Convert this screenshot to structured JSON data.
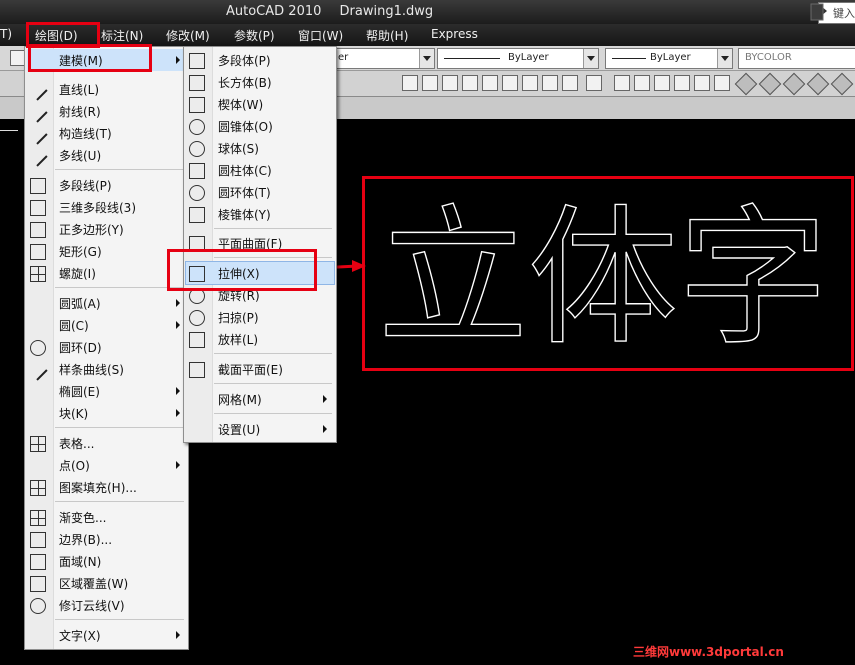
{
  "title_bar": {
    "app": "AutoCAD 2010",
    "doc": "Drawing1.dwg",
    "search_placeholder": "键入"
  },
  "menubar": {
    "items": [
      {
        "label": "T)"
      },
      {
        "label": "绘图(D)"
      },
      {
        "label": "标注(N)"
      },
      {
        "label": "修改(M)"
      },
      {
        "label": "参数(P)"
      },
      {
        "label": "窗口(W)"
      },
      {
        "label": "帮助(H)"
      },
      {
        "label": "Express"
      }
    ]
  },
  "toolbar": {
    "layer_value": "er",
    "linetype_value": "ByLayer",
    "lineweight_value": "ByLayer",
    "color_value": "BYCOLOR"
  },
  "draw_menu": {
    "items": [
      {
        "label": "建模(M)",
        "icon": "",
        "submenu": true
      },
      {
        "label": "直线(L)",
        "icon": "line-icon"
      },
      {
        "label": "射线(R)",
        "icon": "ray-icon"
      },
      {
        "label": "构造线(T)",
        "icon": "xline-icon"
      },
      {
        "label": "多线(U)",
        "icon": "mline-icon"
      },
      {
        "label": "多段线(P)",
        "icon": "polyline-icon"
      },
      {
        "label": "三维多段线(3)",
        "icon": "3dpoly-icon"
      },
      {
        "label": "正多边形(Y)",
        "icon": "polygon-icon"
      },
      {
        "label": "矩形(G)",
        "icon": "rectangle-icon"
      },
      {
        "label": "螺旋(I)",
        "icon": "helix-icon"
      },
      {
        "label": "圆弧(A)",
        "submenu": true
      },
      {
        "label": "圆(C)",
        "submenu": true
      },
      {
        "label": "圆环(D)",
        "icon": "donut-icon"
      },
      {
        "label": "样条曲线(S)",
        "icon": "spline-icon"
      },
      {
        "label": "椭圆(E)",
        "submenu": true
      },
      {
        "label": "块(K)",
        "submenu": true
      },
      {
        "label": "表格...",
        "icon": "table-icon"
      },
      {
        "label": "点(O)",
        "submenu": true
      },
      {
        "label": "图案填充(H)...",
        "icon": "hatch-icon"
      },
      {
        "label": "渐变色...",
        "icon": "gradient-icon"
      },
      {
        "label": "边界(B)...",
        "icon": "boundary-icon"
      },
      {
        "label": "面域(N)",
        "icon": "region-icon"
      },
      {
        "label": "区域覆盖(W)",
        "icon": "wipeout-icon"
      },
      {
        "label": "修订云线(V)",
        "icon": "revcloud-icon"
      },
      {
        "label": "文字(X)",
        "submenu": true
      }
    ]
  },
  "modeling_menu": {
    "items": [
      {
        "label": "多段体(P)",
        "icon": "polysolid-icon"
      },
      {
        "label": "长方体(B)",
        "icon": "box-icon"
      },
      {
        "label": "楔体(W)",
        "icon": "wedge-icon"
      },
      {
        "label": "圆锥体(O)",
        "icon": "cone-icon"
      },
      {
        "label": "球体(S)",
        "icon": "sphere-icon"
      },
      {
        "label": "圆柱体(C)",
        "icon": "cylinder-icon"
      },
      {
        "label": "圆环体(T)",
        "icon": "torus-icon"
      },
      {
        "label": "棱锥体(Y)",
        "icon": "pyramid-icon"
      },
      {
        "label": "平面曲面(F)",
        "icon": "planesurf-icon"
      },
      {
        "label": "拉伸(X)",
        "icon": "extrude-icon"
      },
      {
        "label": "旋转(R)",
        "icon": "revolve-icon"
      },
      {
        "label": "扫掠(P)",
        "icon": "sweep-icon"
      },
      {
        "label": "放样(L)",
        "icon": "loft-icon"
      },
      {
        "label": "截面平面(E)",
        "icon": "sectionplane-icon"
      },
      {
        "label": "网格(M)",
        "submenu": true
      },
      {
        "label": "设置(U)",
        "submenu": true
      }
    ]
  },
  "canvas": {
    "text": "立体字",
    "watermark": "三维网www.3dportal.cn"
  },
  "colors": {
    "highlight_red": "#e60012",
    "canvas_bg": "#000000",
    "menu_bg": "#f4f4f4"
  }
}
